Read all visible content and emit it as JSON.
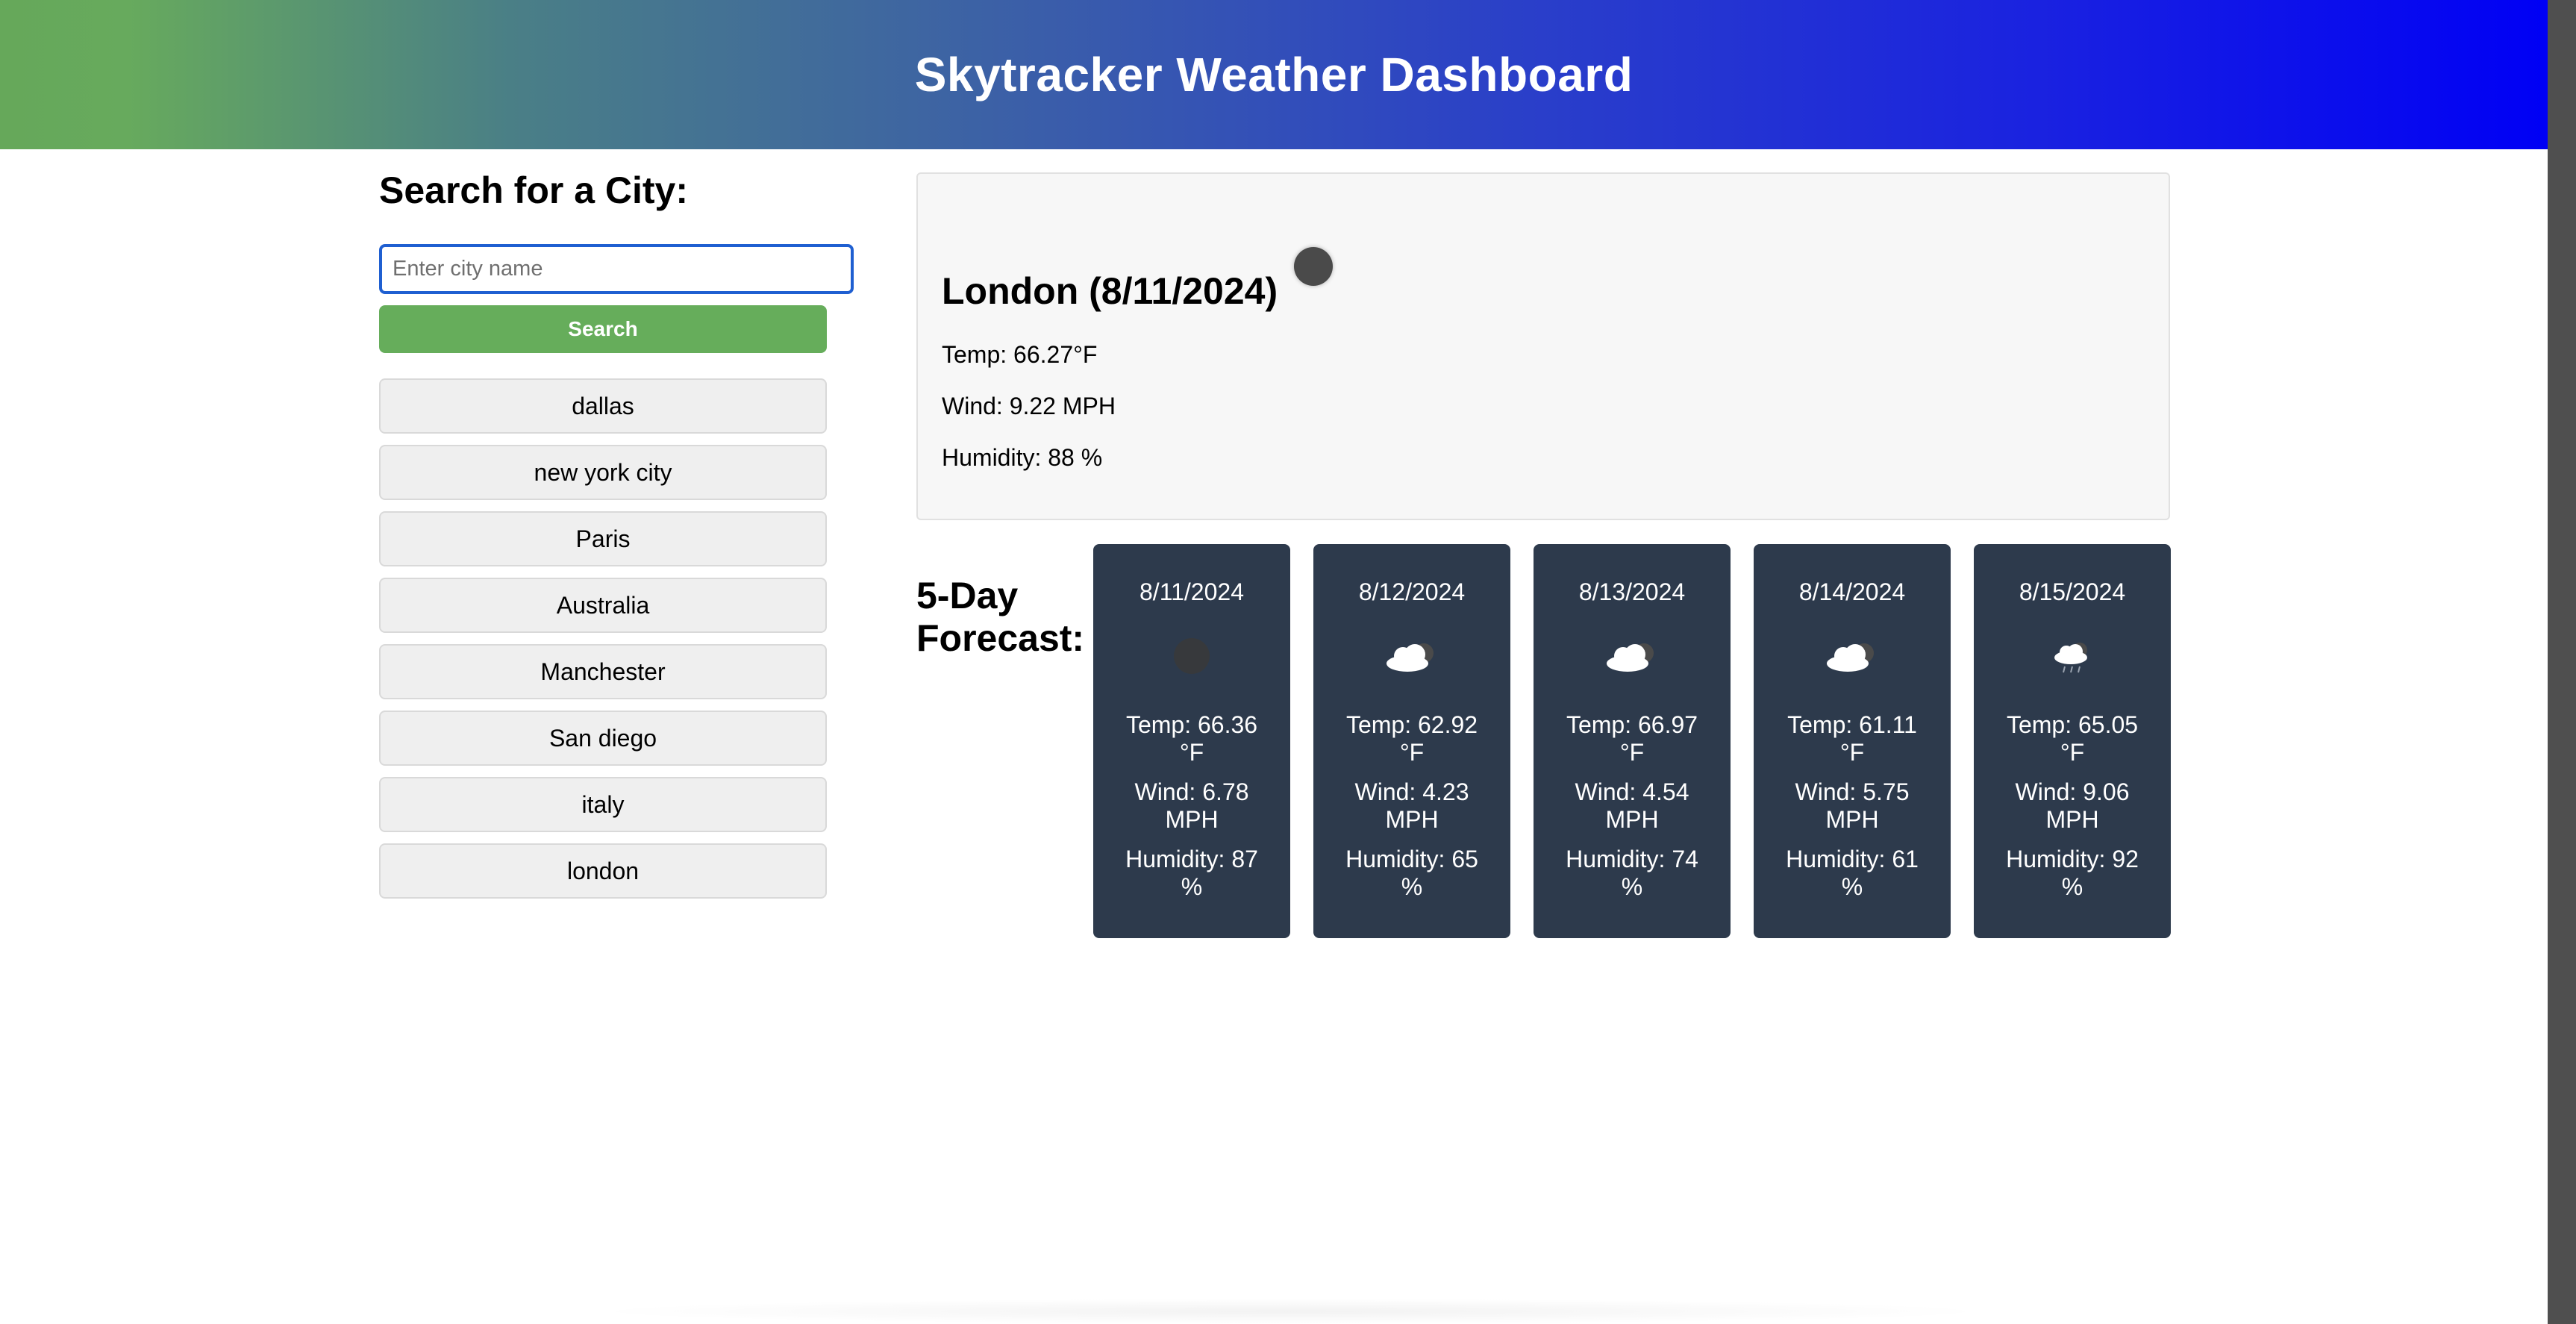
{
  "header": {
    "title": "Skytracker Weather Dashboard"
  },
  "search": {
    "heading": "Search for a City:",
    "placeholder": "Enter city name",
    "value": "",
    "button_label": "Search"
  },
  "history": [
    "dallas",
    "new york city",
    "Paris",
    "Australia",
    "Manchester",
    "San diego",
    "italy",
    "london"
  ],
  "current": {
    "title": "London (8/11/2024)",
    "icon": "dark-circle-icon",
    "temp": "Temp: 66.27°F",
    "wind": "Wind: 9.22 MPH",
    "humidity": "Humidity: 88 %"
  },
  "forecast": {
    "heading_line1": "5-Day",
    "heading_line2": "Forecast:",
    "days": [
      {
        "date": "8/11/2024",
        "icon": "dark-circle-icon",
        "temp_1": "Temp: 66.36",
        "temp_2": "°F",
        "wind_1": "Wind: 6.78",
        "wind_2": "MPH",
        "humidity_1": "Humidity: 87",
        "humidity_2": "%"
      },
      {
        "date": "8/12/2024",
        "icon": "cloud-icon",
        "temp_1": "Temp: 62.92",
        "temp_2": "°F",
        "wind_1": "Wind: 4.23",
        "wind_2": "MPH",
        "humidity_1": "Humidity: 65",
        "humidity_2": "%"
      },
      {
        "date": "8/13/2024",
        "icon": "cloud-icon",
        "temp_1": "Temp: 66.97",
        "temp_2": "°F",
        "wind_1": "Wind: 4.54",
        "wind_2": "MPH",
        "humidity_1": "Humidity: 74",
        "humidity_2": "%"
      },
      {
        "date": "8/14/2024",
        "icon": "cloud-icon",
        "temp_1": "Temp: 61.11",
        "temp_2": "°F",
        "wind_1": "Wind: 5.75",
        "wind_2": "MPH",
        "humidity_1": "Humidity: 61",
        "humidity_2": "%"
      },
      {
        "date": "8/15/2024",
        "icon": "rain-cloud-icon",
        "temp_1": "Temp: 65.05",
        "temp_2": "°F",
        "wind_1": "Wind: 9.06",
        "wind_2": "MPH",
        "humidity_1": "Humidity: 92",
        "humidity_2": "%"
      }
    ]
  },
  "colors": {
    "header_gradient_start": "#66a85a",
    "header_gradient_end": "#0000f5",
    "search_button": "#66ad5b",
    "input_focus_border": "#1f5fd1",
    "forecast_card": "#2d3a4c"
  }
}
